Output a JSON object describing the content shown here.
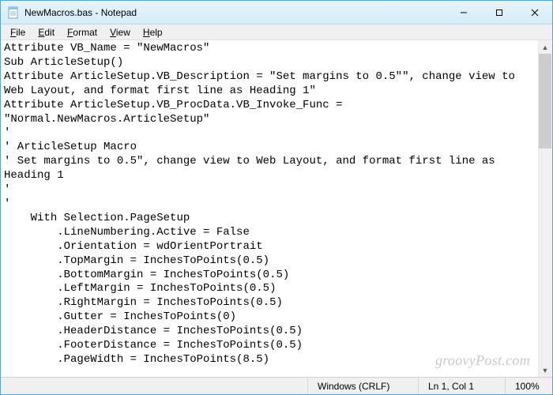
{
  "window": {
    "title": "NewMacros.bas - Notepad"
  },
  "menu": {
    "file": "File",
    "edit": "Edit",
    "format": "Format",
    "view": "View",
    "help": "Help"
  },
  "editor": {
    "content": "Attribute VB_Name = \"NewMacros\"\nSub ArticleSetup()\nAttribute ArticleSetup.VB_Description = \"Set margins to 0.5\"\", change view to Web Layout, and format first line as Heading 1\"\nAttribute ArticleSetup.VB_ProcData.VB_Invoke_Func = \"Normal.NewMacros.ArticleSetup\"\n'\n' ArticleSetup Macro\n' Set margins to 0.5\", change view to Web Layout, and format first line as Heading 1\n'\n'\n    With Selection.PageSetup\n        .LineNumbering.Active = False\n        .Orientation = wdOrientPortrait\n        .TopMargin = InchesToPoints(0.5)\n        .BottomMargin = InchesToPoints(0.5)\n        .LeftMargin = InchesToPoints(0.5)\n        .RightMargin = InchesToPoints(0.5)\n        .Gutter = InchesToPoints(0)\n        .HeaderDistance = InchesToPoints(0.5)\n        .FooterDistance = InchesToPoints(0.5)\n        .PageWidth = InchesToPoints(8.5)"
  },
  "statusbar": {
    "encoding": "Windows (CRLF)",
    "position": "Ln 1, Col 1",
    "zoom": "100%"
  },
  "watermark": "groovyPost.com"
}
